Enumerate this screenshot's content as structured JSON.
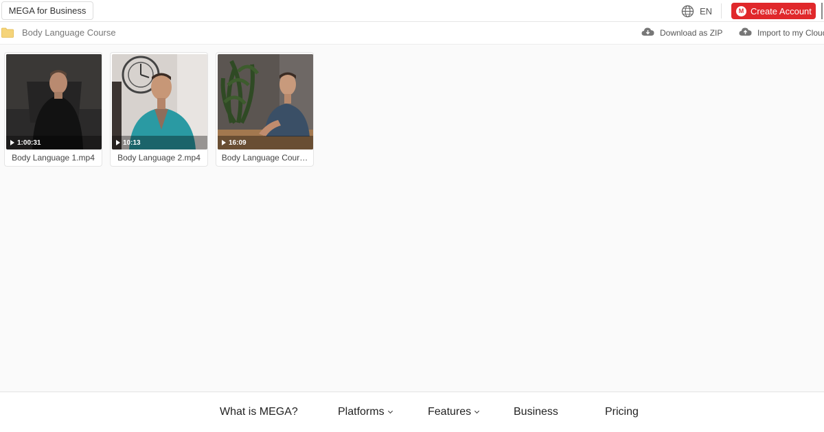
{
  "topbar": {
    "business_label": "MEGA for Business",
    "language": "EN",
    "create_account_label": "Create Account",
    "accent_color": "#e0282b"
  },
  "folder": {
    "name": "Body Language Course",
    "download_zip_label": "Download as ZIP",
    "import_label": "Import to my Cloud"
  },
  "files": [
    {
      "name": "Body Language 1.mp4",
      "duration": "1:00:31",
      "thumbnail": "man-in-black-shirt-dark-room"
    },
    {
      "name": "Body Language 2.mp4",
      "duration": "10:13",
      "thumbnail": "man-in-teal-shirt-clock-wall"
    },
    {
      "name": "Body Language Cour…",
      "duration": "16:09",
      "thumbnail": "man-at-table-with-plant"
    }
  ],
  "footer_nav": {
    "what_is": "What is MEGA?",
    "platforms": "Platforms",
    "features": "Features",
    "business": "Business",
    "pricing": "Pricing"
  },
  "icons": {
    "globe": "globe-icon",
    "folder": "folder-icon",
    "cloud_download": "cloud-download-icon",
    "cloud_import": "cloud-import-icon",
    "play": "play-icon",
    "chevron": "chevron-down-icon"
  }
}
